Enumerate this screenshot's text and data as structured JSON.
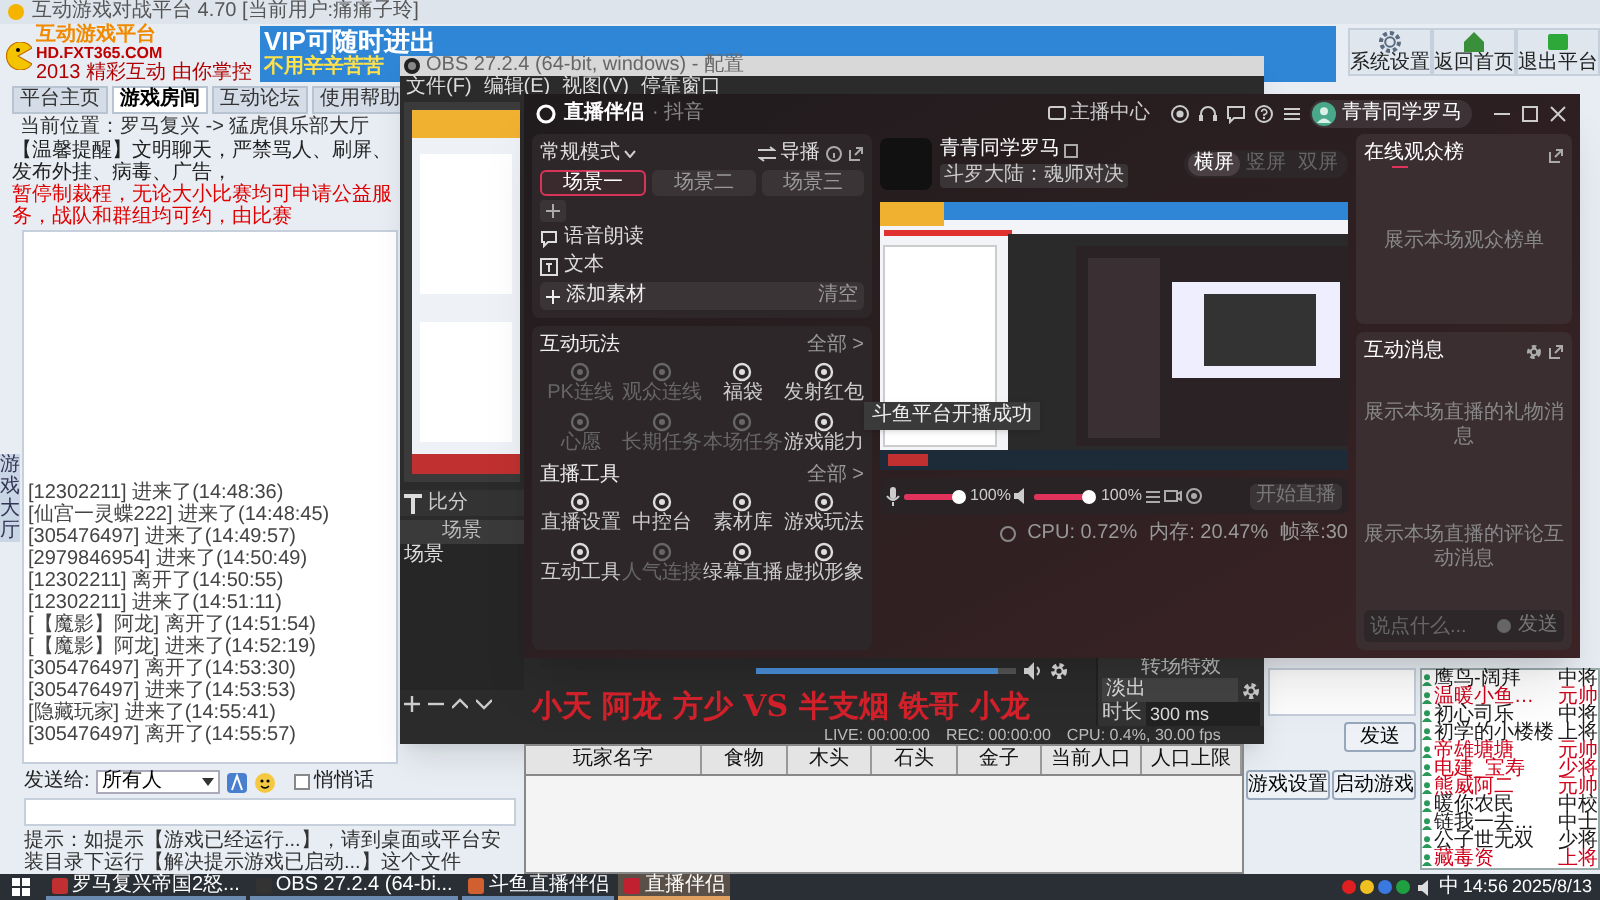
{
  "game_window": {
    "title": "互动游戏对战平台 4.70 [当前用户:痛痛子玲]",
    "logo": {
      "name": "互动游戏平台",
      "url": "HD.FXT365.COM",
      "slogan": "2013 精彩互动 由你掌控"
    },
    "banner": {
      "headline": "VIP可随时进出",
      "subline": "不用辛辛苦苦"
    },
    "toolbar_buttons": [
      "系统设置",
      "返回首页",
      "退出平台"
    ],
    "tabs": [
      {
        "label": "平台主页",
        "selected": false
      },
      {
        "label": "游戏房间",
        "selected": true
      },
      {
        "label": "互动论坛",
        "selected": false
      },
      {
        "label": "使用帮助",
        "selected": false
      }
    ],
    "side_tab": "游戏大厅",
    "location": "当前位置：罗马复兴 -> 猛虎俱乐部大厅",
    "notices": [
      {
        "kind": "tip",
        "text": "【温馨提醒】文明聊天，严禁骂人、刷屏、发布外挂、病毒、广告，"
      },
      {
        "kind": "warning",
        "text": "暂停制裁程，无论大小比赛均可申请公益服务，战队和群组均可约，由比赛"
      }
    ],
    "chat_log": [
      "[12302211] 进来了(14:48:36)",
      "[仙宫一灵蝶222] 进来了(14:48:45)",
      "[305476497] 进来了(14:49:57)",
      "[2979846954] 进来了(14:50:49)",
      "[12302211] 离开了(14:50:55)",
      "[12302211] 进来了(14:51:11)",
      "[【魔影】阿龙] 离开了(14:51:54)",
      "[【魔影】阿龙] 进来了(14:52:19)",
      "[305476497] 离开了(14:53:30)",
      "[305476497] 进来了(14:53:53)",
      "[隐藏玩家] 进来了(14:55:41)",
      "[305476497] 离开了(14:55:57)"
    ],
    "send_to": {
      "label": "发送给:",
      "value": "所有人"
    },
    "whisper": {
      "label": "悄悄话",
      "checked": false
    },
    "hint": "提示：如提示【游戏已经运行...】，请到桌面或平台安装目录下运行【解决提示游戏已启动...】这个文件",
    "send_button": "发送",
    "buttons": [
      "游戏设置",
      "启动游戏"
    ],
    "players": [
      {
        "name": "鹰鸟-阔拜",
        "rank": "中将",
        "color": "#1a1a1a"
      },
      {
        "name": "温暖小鱼…",
        "rank": "元帅",
        "color": "#d0021b"
      },
      {
        "name": "初心司乐",
        "rank": "中将",
        "color": "#1a1a1a"
      },
      {
        "name": "初学的小楼楼",
        "rank": "上将",
        "color": "#1a1a1a"
      },
      {
        "name": "帝雄塘塘",
        "rank": "元帅",
        "color": "#d0021b"
      },
      {
        "name": "电建_宝寿",
        "rank": "少将",
        "color": "#d0021b"
      },
      {
        "name": "熊威阿二",
        "rank": "元帅",
        "color": "#d0021b"
      },
      {
        "name": "暖你农民",
        "rank": "中校",
        "color": "#1a1a1a"
      },
      {
        "name": "链我一去…",
        "rank": "中士",
        "color": "#1a1a1a"
      },
      {
        "name": "公子世无双",
        "rank": "少将",
        "color": "#1a1a1a"
      },
      {
        "name": "藏毒资",
        "rank": "上将",
        "color": "#d0021b"
      }
    ]
  },
  "obs": {
    "title": "OBS 27.2.4 (64-bit, windows) - 配置",
    "menu": [
      "文件(F)",
      "编辑(E)",
      "视图(V)",
      "停靠窗口"
    ],
    "sources": [
      "比分"
    ],
    "scenes_header": "场景",
    "scenes": [
      "场景"
    ],
    "mixer": {
      "level": 0.93
    },
    "transition": {
      "title": "转场特效",
      "effect": "淡出",
      "duration_label": "时长",
      "duration": "300 ms"
    },
    "status": [
      "LIVE: 00:00:00",
      "REC: 00:00:00",
      "CPU: 0.4%, 30.00 fps"
    ]
  },
  "overlay_text": "小天 阿龙 方少 VS 半支烟 铁哥 小龙",
  "companion": {
    "title": "直播伴侣",
    "platform": "· 抖音",
    "anchor_center": "主播中心",
    "user": "青青同学罗马",
    "mode": "常规模式",
    "director": "导播",
    "scenes": [
      {
        "label": "场景一",
        "selected": true
      },
      {
        "label": "场景二",
        "selected": false
      },
      {
        "label": "场景三",
        "selected": false
      }
    ],
    "sources": [
      "语音朗读",
      "文本"
    ],
    "add_source": "添加素材",
    "clear": "清空",
    "sections": [
      {
        "title": "互动玩法",
        "more": "全部 >",
        "items": [
          {
            "label": "PK连线",
            "disabled": true
          },
          {
            "label": "观众连线",
            "disabled": true
          },
          {
            "label": "福袋",
            "disabled": false
          },
          {
            "label": "发射红包",
            "disabled": false
          },
          {
            "label": "心愿",
            "disabled": true
          },
          {
            "label": "长期任务",
            "disabled": true
          },
          {
            "label": "本场任务",
            "disabled": true
          },
          {
            "label": "游戏能力",
            "disabled": false
          }
        ]
      },
      {
        "title": "直播工具",
        "more": "全部 >",
        "items": [
          {
            "label": "直播设置",
            "disabled": false
          },
          {
            "label": "中控台",
            "disabled": false
          },
          {
            "label": "素材库",
            "disabled": false
          },
          {
            "label": "游戏玩法",
            "disabled": false
          },
          {
            "label": "互动工具",
            "disabled": false
          },
          {
            "label": "人气连接",
            "disabled": true
          },
          {
            "label": "绿幕直播",
            "disabled": false
          },
          {
            "label": "虚拟形象",
            "disabled": false
          }
        ]
      }
    ],
    "tooltip": "斗鱼平台开播成功",
    "anchor": {
      "name": "青青同学罗马",
      "tag": "斗罗大陆：魂师对决"
    },
    "screen_modes": [
      {
        "label": "横屏",
        "selected": true
      },
      {
        "label": "竖屏",
        "selected": false
      },
      {
        "label": "双屏",
        "selected": false
      }
    ],
    "mic": {
      "level": 1,
      "reading": "100%"
    },
    "speaker": {
      "level": 1,
      "reading": "100%"
    },
    "start_button": "开始直播",
    "stats": [
      "CPU: 0.72%",
      "内存: 20.47%",
      "帧率:30"
    ],
    "audience": {
      "title": "在线观众榜",
      "empty": "展示本场观众榜单"
    },
    "messages": {
      "title": "互动消息",
      "gift_empty": "展示本场直播的礼物消息",
      "comment_empty": "展示本场直播的评论互动消息",
      "placeholder": "说点什么...",
      "send": "发送"
    }
  },
  "score_table": {
    "columns": [
      "玩家名字",
      "食物",
      "木头",
      "石头",
      "金子",
      "当前人口",
      "人口上限"
    ]
  },
  "taskbar": {
    "items": [
      {
        "label": "罗马复兴帝国2怒...",
        "selected": false
      },
      {
        "label": "OBS 27.2.4 (64-bi...",
        "selected": false
      },
      {
        "label": "斗鱼直播伴侣",
        "selected": false
      },
      {
        "label": "直播伴侣",
        "selected": true
      }
    ],
    "ime": "中",
    "time": "14:56",
    "date": "2025/8/13"
  }
}
